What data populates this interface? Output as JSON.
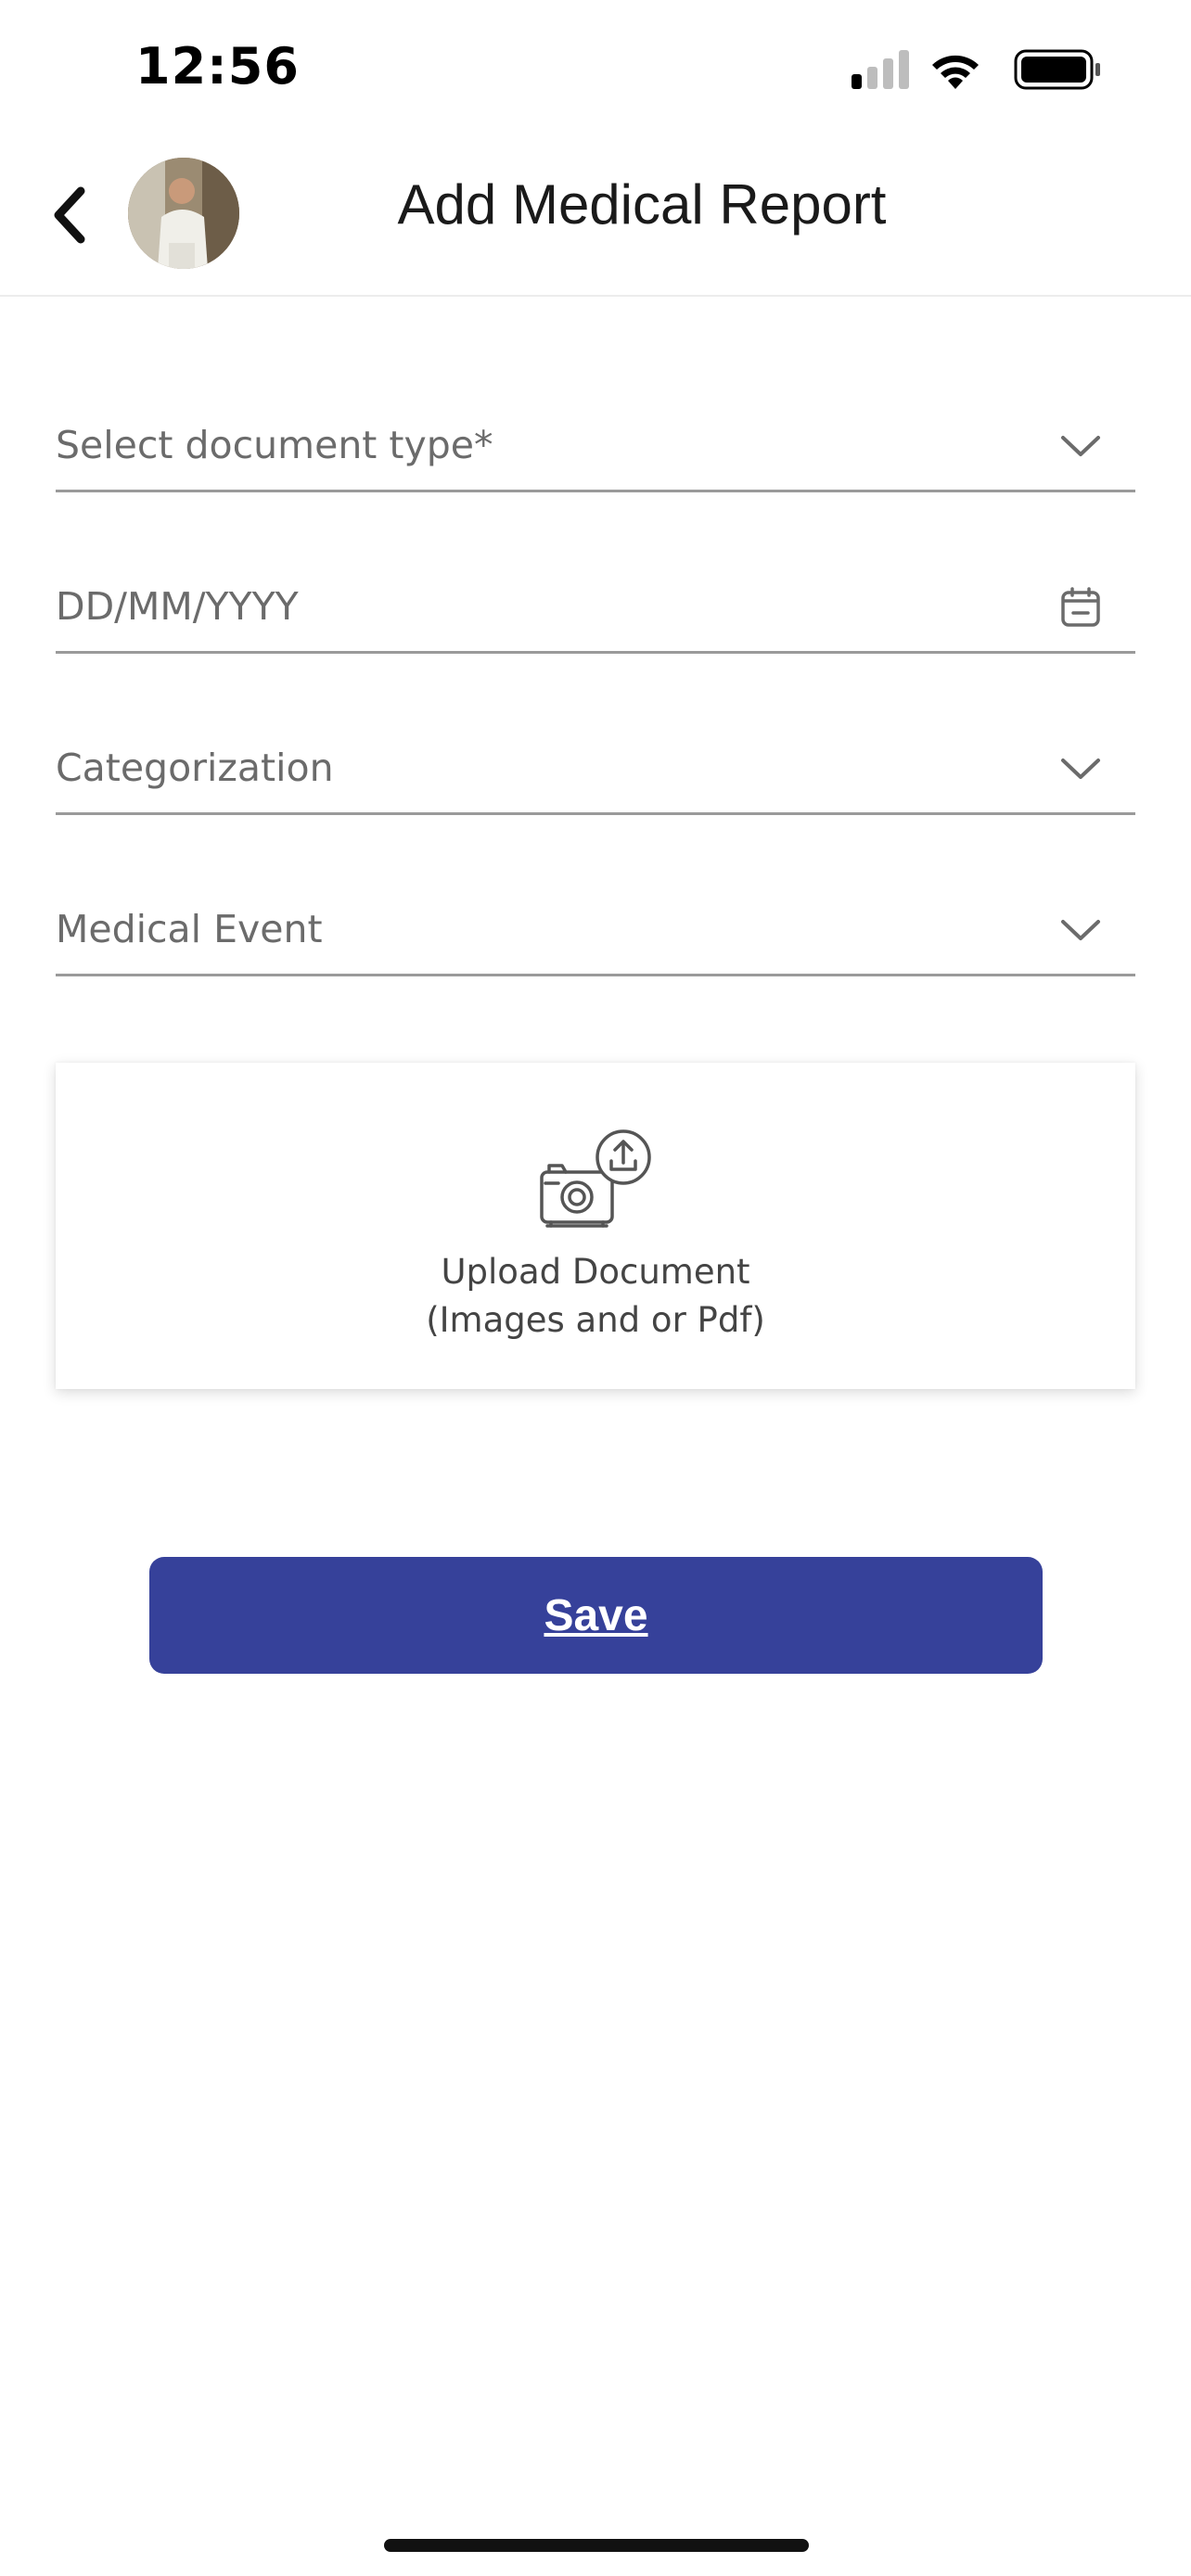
{
  "status_bar": {
    "time": "12:56",
    "icons": [
      "cellular-signal-icon",
      "wifi-icon",
      "battery-icon"
    ]
  },
  "header": {
    "title": "Add Medical Report",
    "back_icon": "chevron-left-icon"
  },
  "form": {
    "document_type": {
      "placeholder": "Select document type*",
      "icon": "chevron-down-icon"
    },
    "date": {
      "placeholder": "DD/MM/YYYY",
      "icon": "calendar-icon"
    },
    "categorization": {
      "placeholder": "Categorization",
      "icon": "chevron-down-icon"
    },
    "medical_event": {
      "placeholder": "Medical Event",
      "icon": "chevron-down-icon"
    }
  },
  "upload": {
    "line1": "Upload Document",
    "line2": "(Images and or Pdf)",
    "icon": "camera-upload-icon"
  },
  "actions": {
    "save_label": "Save"
  },
  "colors": {
    "primary": "#36419a",
    "placeholder": "#6b6b6b",
    "divider": "#9a9a9a"
  }
}
